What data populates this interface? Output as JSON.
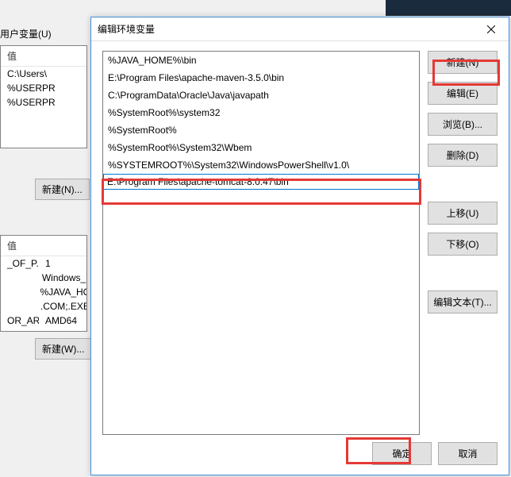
{
  "background": {
    "user_vars_label": "用户变量(U)",
    "value_header": "值",
    "user_rows": [
      "C:\\Users\\",
      "%USERPR",
      "%USERPR"
    ],
    "new_n_button": "新建(N)...",
    "sys_rows_header": "值",
    "sys_rows": [
      {
        "name": "_OF_P...",
        "value": "1"
      },
      {
        "name": "",
        "value": "Windows_"
      },
      {
        "name": "",
        "value": "%JAVA_HO"
      },
      {
        "name": "",
        "value": ".COM;.EXE"
      },
      {
        "name": "OR_AR",
        "value": "AMD64"
      }
    ],
    "new_w_button": "新建(W)..."
  },
  "dialog": {
    "title": "编辑环境变量",
    "list_items": [
      "%JAVA_HOME%\\bin",
      "E:\\Program Files\\apache-maven-3.5.0\\bin",
      "C:\\ProgramData\\Oracle\\Java\\javapath",
      "%SystemRoot%\\system32",
      "%SystemRoot%",
      "%SystemRoot%\\System32\\Wbem",
      "%SYSTEMROOT%\\System32\\WindowsPowerShell\\v1.0\\"
    ],
    "editing_value": "E:\\Program Files\\apache-tomcat-8.0.47\\bin",
    "buttons": {
      "new": "新建(N)",
      "edit": "编辑(E)",
      "browse": "浏览(B)...",
      "delete": "删除(D)",
      "move_up": "上移(U)",
      "move_down": "下移(O)",
      "edit_text": "编辑文本(T)...",
      "ok": "确定",
      "cancel": "取消"
    }
  }
}
